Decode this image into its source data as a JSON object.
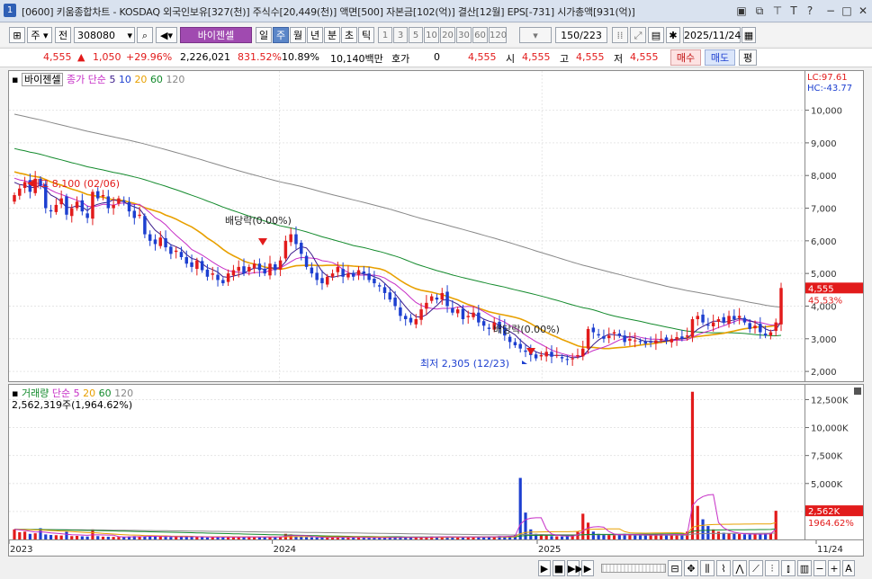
{
  "window": {
    "number": "1",
    "title": "[0600] 키움종합차트 - KOSDAQ 외국인보유[327(천)] 주식수[20,449(천)] 액면[500] 자본금[102(억)] 결산[12월] EPS[-731] 시가총액[931(억)]"
  },
  "toolbar": {
    "period": "주",
    "mode": "전",
    "code": "308080",
    "stock_name": "바이젠셀",
    "tabs": [
      "일",
      "주",
      "월",
      "년",
      "분",
      "초",
      "틱"
    ],
    "active_tab": "주",
    "intervals": [
      "1",
      "3",
      "5",
      "10",
      "20",
      "30",
      "60",
      "120"
    ],
    "count": "150/223",
    "date": "2025/11/24"
  },
  "quote": {
    "price": "4,555",
    "change": "1,050",
    "change_pct": "+29.96%",
    "volume": "2,226,021",
    "volume_pct": "831.52%",
    "turnover": "10.89%",
    "amount": "10,140백만",
    "hoga_label": "호가",
    "hoga_value": "0",
    "ask_price": "4,555",
    "open_label": "시",
    "open": "4,555",
    "high_label": "고",
    "high": "4,555",
    "low_label": "저",
    "low": "4,555",
    "buy_label": "매수",
    "sell_label": "매도",
    "eval_label": "평"
  },
  "price_panel": {
    "legend_name": "바이젠셀",
    "legend_ma": "종가 단순",
    "legend_periods": [
      "5",
      "10",
      "20",
      "60",
      "120"
    ],
    "lc": "LC:97.61",
    "hc": "HC:-43.77",
    "annotation_high": "최고 8,100 (02/06)",
    "annotation_low": "최저 2,305 (12/23)",
    "annotation_div1": "배당락(0.00%)",
    "annotation_div2": "배당락(0.00%)",
    "current_price_tag": "4,555",
    "current_pct_tag": "45.53%"
  },
  "volume_panel": {
    "legend_name": "거래량",
    "legend_ma": "단순",
    "legend_periods": [
      "5",
      "20",
      "60",
      "120"
    ],
    "value_text": "2,562,319주(1,964.62%)",
    "current_tag": "2,562K",
    "pct_tag": "1964.62%"
  },
  "colors": {
    "up": "#e21b1b",
    "down": "#1d3fd0",
    "ma5": "#3a1a8a",
    "ma10": "#c62ec6",
    "ma20": "#e8a000",
    "ma60": "#138a2c",
    "ma120": "#888888"
  },
  "chart_data": {
    "type": "candlestick",
    "timeframe": "weekly",
    "x_labels": [
      "2023",
      "2024",
      "2025",
      "11/24"
    ],
    "y_ticks": [
      "10,000",
      "9,000",
      "8,000",
      "7,000",
      "6,000",
      "5,000",
      "4,000",
      "3,000",
      "2,000"
    ],
    "ylim": [
      1700,
      11200
    ],
    "volume_ticks": [
      "12,500K",
      "10,000K",
      "7,500K",
      "5,000K",
      "2,500K"
    ],
    "volume_ylim": [
      0,
      13500
    ],
    "weekly_close": [
      7400,
      7600,
      7800,
      7500,
      7900,
      7700,
      7000,
      6900,
      7100,
      7300,
      6800,
      7000,
      7200,
      6900,
      6700,
      7500,
      7300,
      7400,
      7000,
      7100,
      7300,
      7200,
      6900,
      6700,
      6800,
      6200,
      6000,
      5900,
      6100,
      5800,
      5600,
      5700,
      5500,
      5300,
      5200,
      5400,
      5100,
      4900,
      5000,
      4800,
      4700,
      5000,
      5100,
      5200,
      5000,
      5200,
      5300,
      5100,
      5000,
      5300,
      5100,
      5400,
      6000,
      6200,
      5900,
      5600,
      5200,
      5000,
      4800,
      4700,
      4900,
      5000,
      5200,
      4900,
      5000,
      4900,
      5100,
      5000,
      4800,
      4700,
      4600,
      4400,
      4200,
      4000,
      3700,
      3600,
      3500,
      3600,
      3900,
      4100,
      4300,
      4200,
      4400,
      4000,
      3800,
      3900,
      3600,
      3700,
      3800,
      3500,
      3400,
      3300,
      3500,
      3300,
      3100,
      2900,
      2800,
      2700,
      2600,
      2500,
      2400,
      2500,
      2600,
      2450,
      2500,
      2400,
      2350,
      2400,
      2500,
      2700,
      3300,
      3200,
      3100,
      3000,
      3100,
      3200,
      3100,
      2900,
      3000,
      2950,
      2900,
      2850,
      2900,
      2950,
      3000,
      2950,
      3000,
      3050,
      3000,
      3100,
      3600,
      3700,
      3500,
      3400,
      3500,
      3600,
      3500,
      3700,
      3600,
      3700,
      3500,
      3300,
      3400,
      3200,
      3100,
      3200,
      3500,
      4555
    ],
    "weekly_volume_k": [
      900,
      650,
      700,
      500,
      550,
      1000,
      450,
      400,
      380,
      350,
      700,
      300,
      320,
      280,
      260,
      900,
      300,
      250,
      240,
      230,
      220,
      200,
      260,
      300,
      250,
      280,
      330,
      260,
      240,
      230,
      220,
      270,
      260,
      240,
      220,
      230,
      200,
      180,
      210,
      230,
      220,
      200,
      190,
      210,
      220,
      250,
      230,
      200,
      210,
      240,
      230,
      260,
      500,
      450,
      280,
      240,
      200,
      190,
      180,
      170,
      200,
      180,
      190,
      170,
      160,
      170,
      180,
      160,
      150,
      140,
      160,
      170,
      180,
      200,
      210,
      170,
      160,
      170,
      190,
      220,
      260,
      240,
      250,
      220,
      210,
      200,
      240,
      230,
      220,
      210,
      230,
      260,
      250,
      300,
      280,
      320,
      380,
      5500,
      2400,
      900,
      500,
      400,
      350,
      300,
      280,
      260,
      300,
      380,
      700,
      2300,
      1500,
      700,
      500,
      450,
      400,
      380,
      420,
      500,
      450,
      400,
      380,
      360,
      400,
      450,
      500,
      420,
      380,
      400,
      450,
      700,
      13200,
      3000,
      1800,
      1200,
      900,
      700,
      600,
      550,
      500,
      480,
      460,
      450,
      500,
      480,
      520,
      600,
      2562
    ]
  }
}
